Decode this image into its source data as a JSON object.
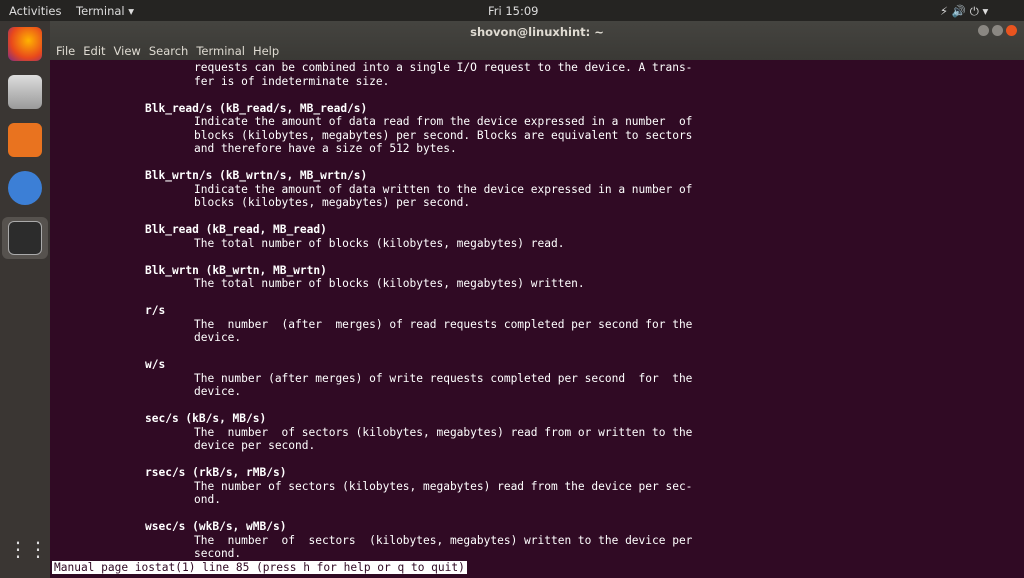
{
  "topbar": {
    "activities": "Activities",
    "app": "Terminal ▾",
    "clock": "Fri 15:09",
    "tray": "⚡ 🔊 ⏻ ▾"
  },
  "dock": {
    "items": [
      "firefox-icon",
      "files-icon",
      "software-icon",
      "help-icon",
      "terminal-icon",
      "apps-grid-icon"
    ]
  },
  "window": {
    "title": "shovon@linuxhint: ~",
    "menu": [
      "File",
      "Edit",
      "View",
      "Search",
      "Terminal",
      "Help"
    ]
  },
  "lines": [
    {
      "r": 0,
      "t": "b",
      "s": "requests can be combined into a single I/O request to the device. A trans-"
    },
    {
      "r": 1,
      "t": "b",
      "s": "fer is of indeterminate size."
    },
    {
      "r": 3,
      "t": "h",
      "s": "Blk_read/s (kB_read/s, MB_read/s)"
    },
    {
      "r": 4,
      "t": "b",
      "s": "Indicate the amount of data read from the device expressed in a number  of"
    },
    {
      "r": 5,
      "t": "b",
      "s": "blocks (kilobytes, megabytes) per second. Blocks are equivalent to sectors"
    },
    {
      "r": 6,
      "t": "b",
      "s": "and therefore have a size of 512 bytes."
    },
    {
      "r": 8,
      "t": "h",
      "s": "Blk_wrtn/s (kB_wrtn/s, MB_wrtn/s)"
    },
    {
      "r": 9,
      "t": "b",
      "s": "Indicate the amount of data written to the device expressed in a number of"
    },
    {
      "r": 10,
      "t": "b",
      "s": "blocks (kilobytes, megabytes) per second."
    },
    {
      "r": 12,
      "t": "h",
      "s": "Blk_read (kB_read, MB_read)"
    },
    {
      "r": 13,
      "t": "b",
      "s": "The total number of blocks (kilobytes, megabytes) read."
    },
    {
      "r": 15,
      "t": "h",
      "s": "Blk_wrtn (kB_wrtn, MB_wrtn)"
    },
    {
      "r": 16,
      "t": "b",
      "s": "The total number of blocks (kilobytes, megabytes) written."
    },
    {
      "r": 18,
      "t": "h",
      "s": "r/s"
    },
    {
      "r": 19,
      "t": "b",
      "s": "The  number  (after  merges) of read requests completed per second for the"
    },
    {
      "r": 20,
      "t": "b",
      "s": "device."
    },
    {
      "r": 22,
      "t": "h",
      "s": "w/s"
    },
    {
      "r": 23,
      "t": "b",
      "s": "The number (after merges) of write requests completed per second  for  the"
    },
    {
      "r": 24,
      "t": "b",
      "s": "device."
    },
    {
      "r": 26,
      "t": "h",
      "s": "sec/s (kB/s, MB/s)"
    },
    {
      "r": 27,
      "t": "b",
      "s": "The  number  of sectors (kilobytes, megabytes) read from or written to the"
    },
    {
      "r": 28,
      "t": "b",
      "s": "device per second."
    },
    {
      "r": 30,
      "t": "h",
      "s": "rsec/s (rkB/s, rMB/s)"
    },
    {
      "r": 31,
      "t": "b",
      "s": "The number of sectors (kilobytes, megabytes) read from the device per sec-"
    },
    {
      "r": 32,
      "t": "b",
      "s": "ond."
    },
    {
      "r": 34,
      "t": "h",
      "s": "wsec/s (wkB/s, wMB/s)"
    },
    {
      "r": 35,
      "t": "b",
      "s": "The  number  of  sectors  (kilobytes, megabytes) written to the device per"
    },
    {
      "r": 36,
      "t": "b",
      "s": "second."
    }
  ],
  "status": "Manual page iostat(1) line 85 (press h for help or q to quit)"
}
